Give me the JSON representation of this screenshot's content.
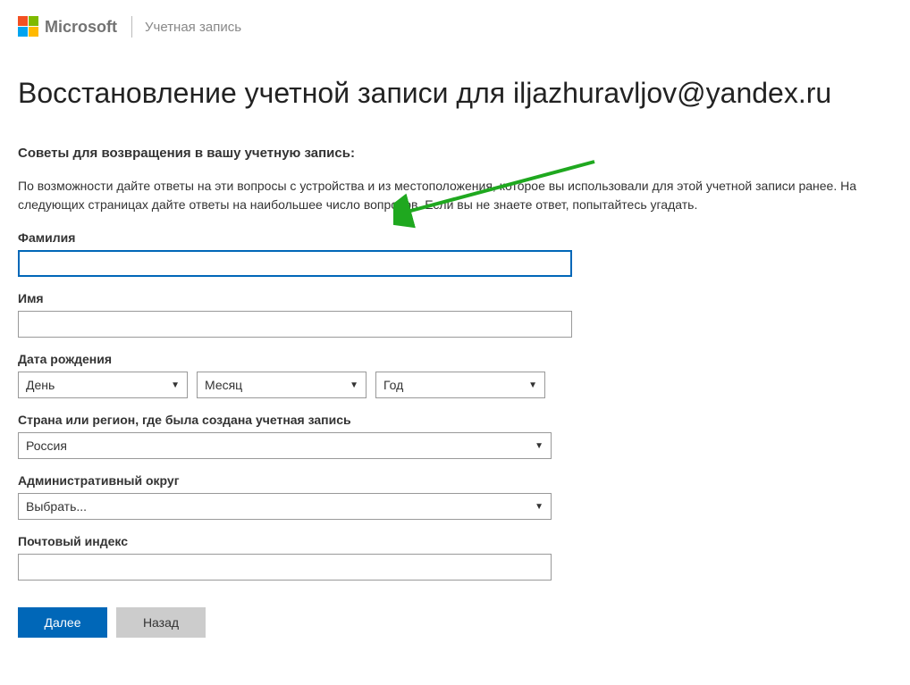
{
  "header": {
    "brand": "Microsoft",
    "section": "Учетная запись"
  },
  "page": {
    "title_prefix": "Восстановление учетной записи для ",
    "title_email": "iljazhuravljov@yandex.ru"
  },
  "tips": {
    "heading": "Советы для возвращения в вашу учетную запись:",
    "text": "По возможности дайте ответы на эти вопросы с устройства и из местоположения, которое вы использовали для этой учетной записи ранее. На следующих страницах дайте ответы на наибольшее число вопросов. Если вы не знаете ответ, попытайтесь угадать."
  },
  "fields": {
    "lastname": {
      "label": "Фамилия",
      "value": ""
    },
    "firstname": {
      "label": "Имя",
      "value": ""
    },
    "dob": {
      "label": "Дата рождения",
      "day": "День",
      "month": "Месяц",
      "year": "Год"
    },
    "country": {
      "label": "Страна или регион, где была создана учетная запись",
      "value": "Россия"
    },
    "district": {
      "label": "Административный округ",
      "value": "Выбрать..."
    },
    "postal": {
      "label": "Почтовый индекс",
      "value": ""
    }
  },
  "buttons": {
    "next": "Далее",
    "back": "Назад"
  }
}
